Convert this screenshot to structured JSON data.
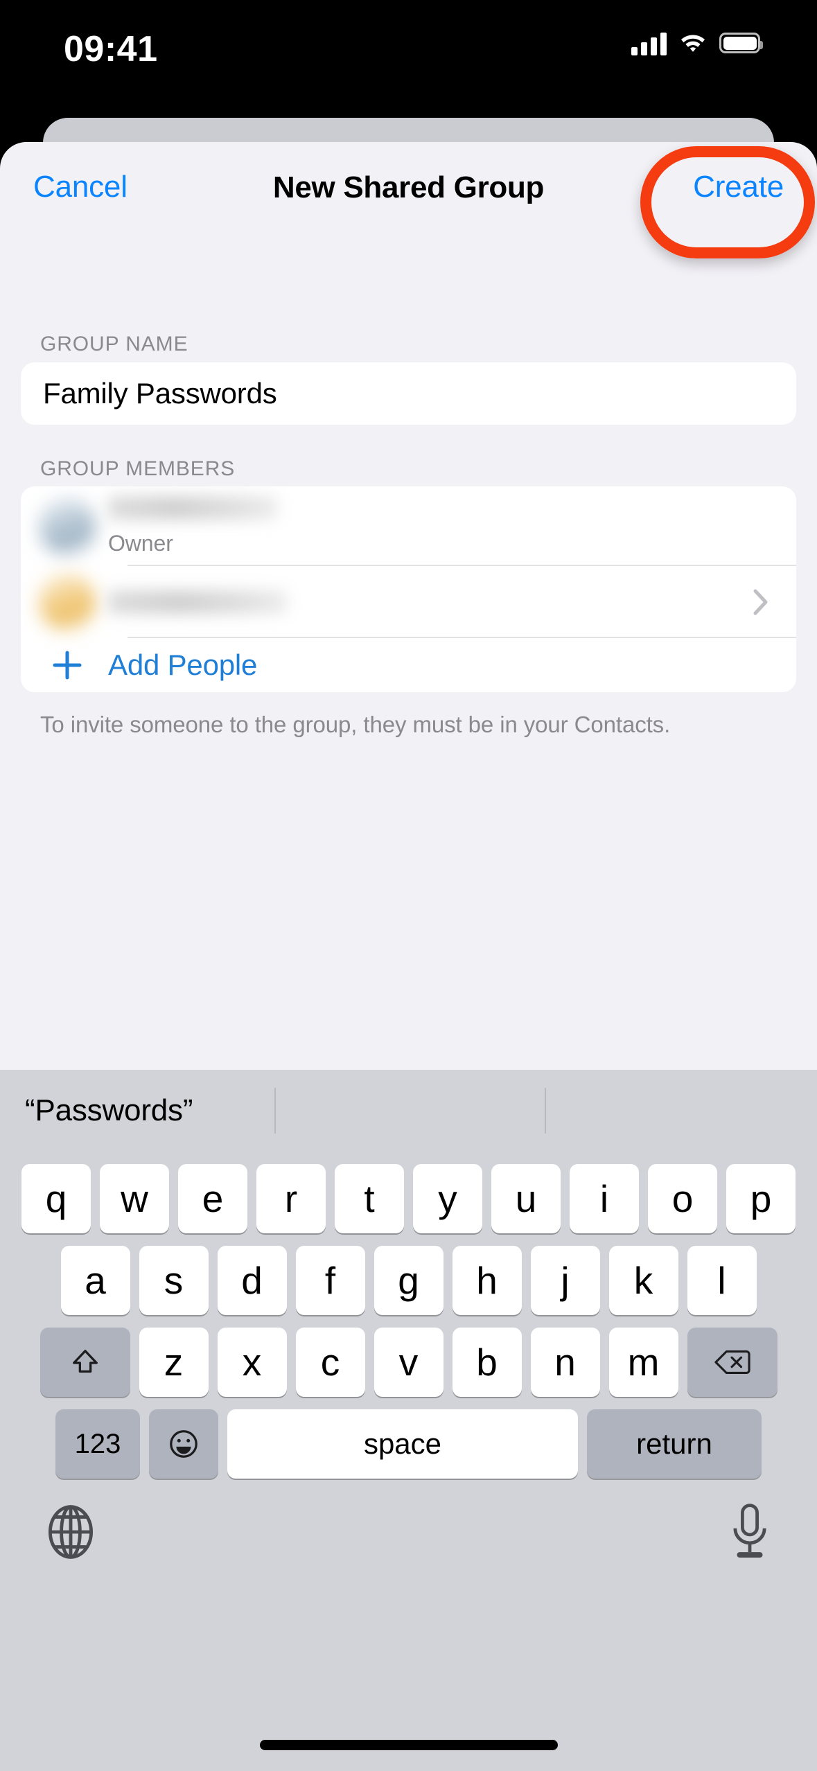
{
  "status_bar": {
    "time": "09:41",
    "icons": [
      "cellular-signal-icon",
      "wifi-icon",
      "battery-icon"
    ]
  },
  "sheet": {
    "nav": {
      "cancel_label": "Cancel",
      "title": "New Shared Group",
      "create_label": "Create",
      "accent_color": "#0a84ff",
      "highlight_color": "#f53b10"
    },
    "group_name_section": {
      "header": "GROUP NAME",
      "value": "Family Passwords",
      "placeholder": "Group Name"
    },
    "group_members_section": {
      "header": "GROUP MEMBERS",
      "members": [
        {
          "name": "",
          "subtitle": "Owner",
          "avatar_color": "#b9c9d6",
          "redacted": "true"
        },
        {
          "name": "",
          "subtitle": "",
          "avatar_color": "#f3cf8a",
          "redacted": "true"
        }
      ],
      "add_people_label": "Add People",
      "add_icon": "plus-icon",
      "footnote": "To invite someone to the group, they must be in your Contacts."
    }
  },
  "keyboard": {
    "predictions": [
      "“Passwords”",
      "",
      ""
    ],
    "rows": [
      [
        "q",
        "w",
        "e",
        "r",
        "t",
        "y",
        "u",
        "i",
        "o",
        "p"
      ],
      [
        "a",
        "s",
        "d",
        "f",
        "g",
        "h",
        "j",
        "k",
        "l"
      ],
      [
        "z",
        "x",
        "c",
        "v",
        "b",
        "n",
        "m"
      ]
    ],
    "shift_icon": "shift-arrow-icon",
    "backspace_icon": "backspace-delete-icon",
    "numbers_label": "123",
    "emoji_icon": "emoji-smiley-icon",
    "space_label": "space",
    "return_label": "return",
    "globe_icon": "globe-language-icon",
    "mic_icon": "microphone-dictation-icon",
    "background_color": "#d1d3d9"
  }
}
